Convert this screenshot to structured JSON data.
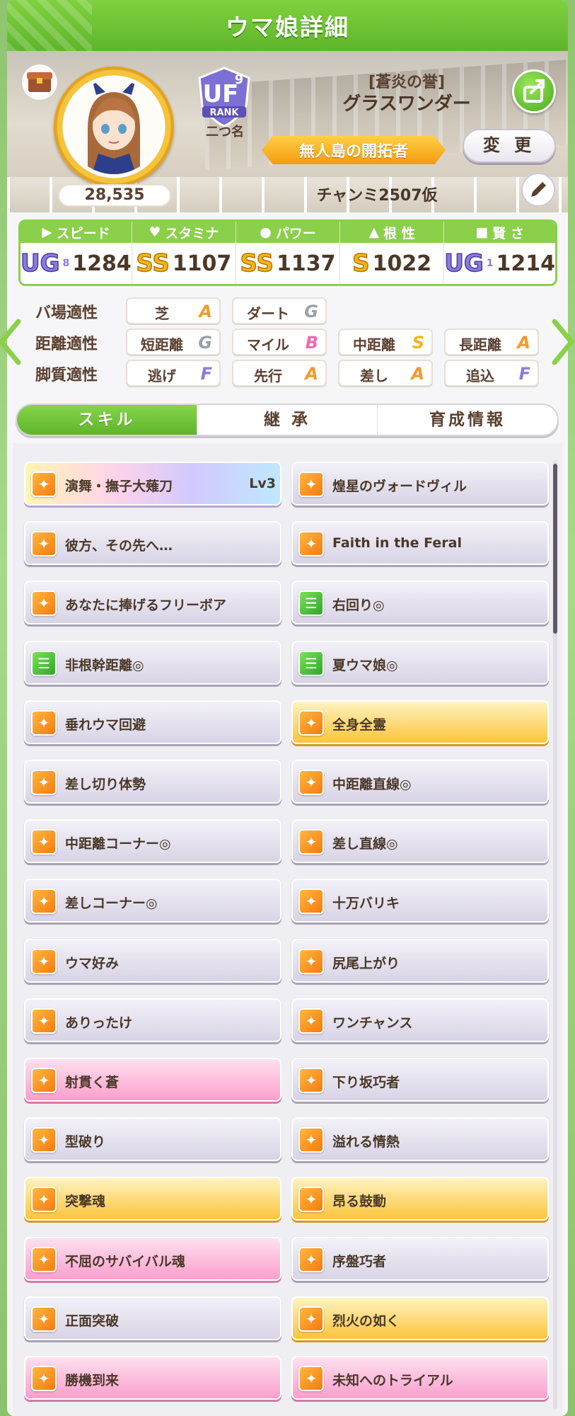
{
  "header": {
    "title": "ウマ娘詳細"
  },
  "profile": {
    "epithet": "[蒼炎の誉]",
    "name": "グラスワンダー",
    "fans": "28,535",
    "rank": {
      "letters": "UF",
      "num": "9",
      "label": "RANK"
    },
    "nickname": "二つ名",
    "title_badge": "無人島の開拓者",
    "change_label": "変 更",
    "trainer": "チャンミ2507仮"
  },
  "stats": [
    {
      "label": "スピード",
      "icon": "shoe-icon",
      "grade": "UG",
      "sub": "8",
      "value": "1284"
    },
    {
      "label": "スタミナ",
      "icon": "heart-icon",
      "grade": "SS",
      "sub": "",
      "value": "1107"
    },
    {
      "label": "パワー",
      "icon": "muscle-icon",
      "grade": "SS",
      "sub": "",
      "value": "1137"
    },
    {
      "label": "根 性",
      "icon": "flame-icon",
      "grade": "S",
      "sub": "",
      "value": "1022"
    },
    {
      "label": "賢 さ",
      "icon": "graduation-cap-icon",
      "grade": "UG",
      "sub": "1",
      "value": "1214"
    }
  ],
  "aptitude": {
    "track": {
      "label": "バ場適性",
      "items": [
        {
          "name": "芝",
          "rank": "A"
        },
        {
          "name": "ダート",
          "rank": "G"
        }
      ]
    },
    "distance": {
      "label": "距離適性",
      "items": [
        {
          "name": "短距離",
          "rank": "G"
        },
        {
          "name": "マイル",
          "rank": "B"
        },
        {
          "name": "中距離",
          "rank": "S"
        },
        {
          "name": "長距離",
          "rank": "A"
        }
      ]
    },
    "style": {
      "label": "脚質適性",
      "items": [
        {
          "name": "逃げ",
          "rank": "F"
        },
        {
          "name": "先行",
          "rank": "A"
        },
        {
          "name": "差し",
          "rank": "A"
        },
        {
          "name": "追込",
          "rank": "F"
        }
      ]
    }
  },
  "tabs": [
    {
      "label": "スキル",
      "active": true
    },
    {
      "label": "継 承",
      "active": false
    },
    {
      "label": "育成情報",
      "active": false
    }
  ],
  "skills": [
    {
      "name": "演舞・撫子大薙刀",
      "lv": "Lv3",
      "style": "rainbow",
      "icon": "orange"
    },
    {
      "name": "煌星のヴォードヴィル",
      "lv": "",
      "style": "normal",
      "icon": "orange"
    },
    {
      "name": "彼方、その先へ…",
      "lv": "",
      "style": "normal",
      "icon": "orange"
    },
    {
      "name": "Faith in the Feral",
      "lv": "",
      "style": "normal",
      "icon": "orange"
    },
    {
      "name": "あなたに捧げるフリーボア",
      "lv": "",
      "style": "normal",
      "icon": "orange"
    },
    {
      "name": "右回り◎",
      "lv": "",
      "style": "normal",
      "icon": "green"
    },
    {
      "name": "非根幹距離◎",
      "lv": "",
      "style": "normal",
      "icon": "green"
    },
    {
      "name": "夏ウマ娘◎",
      "lv": "",
      "style": "normal",
      "icon": "green"
    },
    {
      "name": "垂れウマ回避",
      "lv": "",
      "style": "normal",
      "icon": "orange"
    },
    {
      "name": "全身全霊",
      "lv": "",
      "style": "gold",
      "icon": "orange"
    },
    {
      "name": "差し切り体勢",
      "lv": "",
      "style": "normal",
      "icon": "orange"
    },
    {
      "name": "中距離直線◎",
      "lv": "",
      "style": "normal",
      "icon": "orange"
    },
    {
      "name": "中距離コーナー◎",
      "lv": "",
      "style": "normal",
      "icon": "orange"
    },
    {
      "name": "差し直線◎",
      "lv": "",
      "style": "normal",
      "icon": "orange"
    },
    {
      "name": "差しコーナー◎",
      "lv": "",
      "style": "normal",
      "icon": "orange"
    },
    {
      "name": "十万バリキ",
      "lv": "",
      "style": "normal",
      "icon": "orange"
    },
    {
      "name": "ウマ好み",
      "lv": "",
      "style": "normal",
      "icon": "orange"
    },
    {
      "name": "尻尾上がり",
      "lv": "",
      "style": "normal",
      "icon": "orange"
    },
    {
      "name": "ありったけ",
      "lv": "",
      "style": "normal",
      "icon": "orange"
    },
    {
      "name": "ワンチャンス",
      "lv": "",
      "style": "normal",
      "icon": "orange"
    },
    {
      "name": "射貫く蒼",
      "lv": "",
      "style": "pink",
      "icon": "orange"
    },
    {
      "name": "下り坂巧者",
      "lv": "",
      "style": "normal",
      "icon": "orange"
    },
    {
      "name": "型破り",
      "lv": "",
      "style": "normal",
      "icon": "orange"
    },
    {
      "name": "溢れる情熱",
      "lv": "",
      "style": "normal",
      "icon": "orange"
    },
    {
      "name": "突撃魂",
      "lv": "",
      "style": "gold",
      "icon": "orange"
    },
    {
      "name": "昂る鼓動",
      "lv": "",
      "style": "gold",
      "icon": "orange"
    },
    {
      "name": "不屈のサバイバル魂",
      "lv": "",
      "style": "pink",
      "icon": "orange"
    },
    {
      "name": "序盤巧者",
      "lv": "",
      "style": "normal",
      "icon": "orange"
    },
    {
      "name": "正面突破",
      "lv": "",
      "style": "normal",
      "icon": "orange"
    },
    {
      "name": "烈火の如く",
      "lv": "",
      "style": "gold",
      "icon": "orange"
    },
    {
      "name": "勝機到来",
      "lv": "",
      "style": "pink",
      "icon": "orange"
    },
    {
      "name": "未知へのトライアル",
      "lv": "",
      "style": "pink",
      "icon": "orange"
    }
  ]
}
